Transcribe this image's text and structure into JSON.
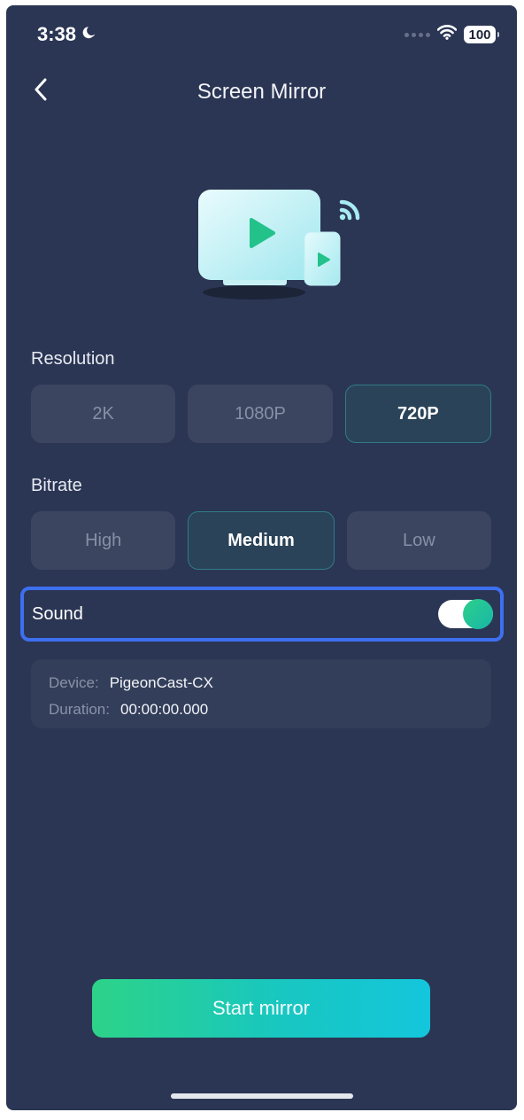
{
  "status_bar": {
    "time": "3:38",
    "battery": "100",
    "icons": [
      "moon-icon",
      "signal-dots-icon",
      "wifi-icon",
      "battery-icon"
    ]
  },
  "header": {
    "title": "Screen Mirror",
    "back_icon": "chevron-left-icon"
  },
  "illustration": {
    "icon": "screen-mirror-illustration"
  },
  "resolution": {
    "label": "Resolution",
    "options": [
      "2K",
      "1080P",
      "720P"
    ],
    "selected": "720P"
  },
  "bitrate": {
    "label": "Bitrate",
    "options": [
      "High",
      "Medium",
      "Low"
    ],
    "selected": "Medium"
  },
  "sound": {
    "label": "Sound",
    "enabled": true
  },
  "info": {
    "device_key": "Device:",
    "device_value": "PigeonCast-CX",
    "duration_key": "Duration:",
    "duration_value": "00:00:00.000"
  },
  "start_button": {
    "label": "Start mirror"
  },
  "colors": {
    "background": "#2b3654",
    "option": "#3b4560",
    "selected_border": "#2f7c86",
    "accent_start": "#2dd388",
    "accent_end": "#14c6dc",
    "focus_outline": "#3d6ff0"
  }
}
